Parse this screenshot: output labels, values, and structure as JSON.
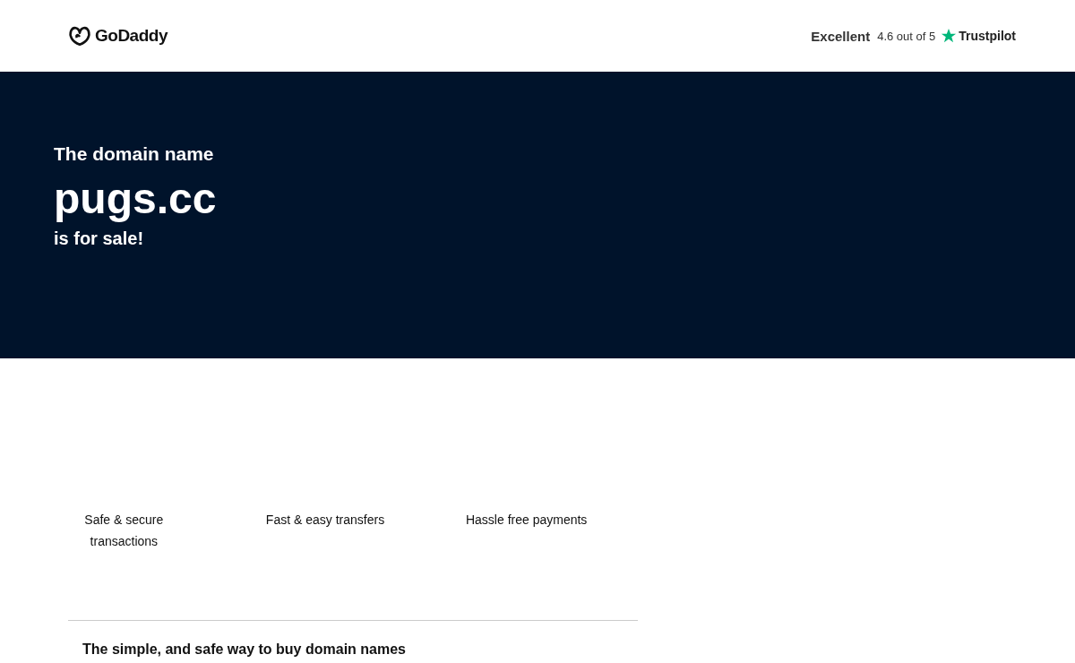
{
  "header": {
    "logo": "GoDaddy",
    "rating_label": "Excellent",
    "rating_score": "4.6 out of 5",
    "review_site": "Trustpilot"
  },
  "hero": {
    "intro": "The domain name",
    "domain": "pugs.cc",
    "outro": "is for sale!"
  },
  "features": [
    {
      "label": "Safe & secure transactions"
    },
    {
      "label": "Fast & easy transfers"
    },
    {
      "label": "Hassle free payments"
    }
  ],
  "section_heading": "The simple, and safe way to buy domain names"
}
